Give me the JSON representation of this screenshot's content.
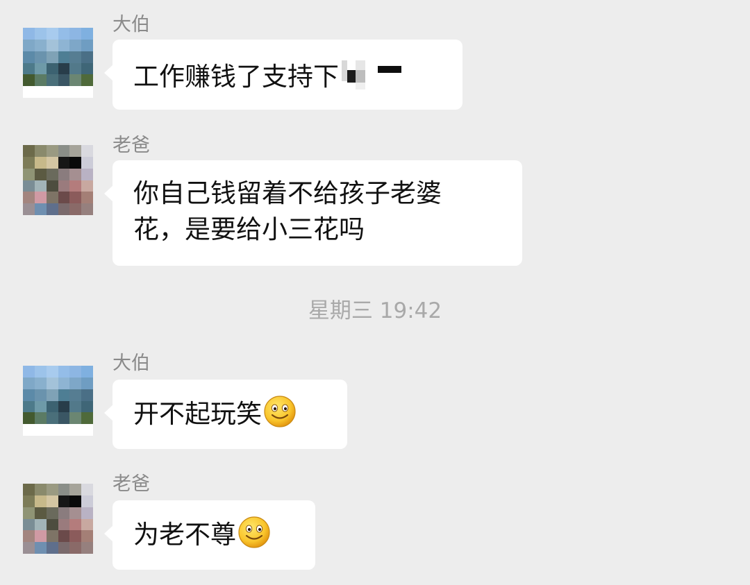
{
  "chat": {
    "messages": [
      {
        "sender": "大伯",
        "lines": [
          "工作赚钱了支持下"
        ],
        "attachment": "redacted-text-mosaic"
      },
      {
        "sender": "老爸",
        "lines": [
          "你自己钱留着不给孩子老婆",
          "花，是要给小三花吗"
        ]
      },
      {
        "sender": "大伯",
        "lines": [
          "开不起玩笑"
        ],
        "emoji": "smile-emoji"
      },
      {
        "sender": "老爸",
        "lines": [
          "为老不尊"
        ],
        "emoji": "smile-emoji"
      }
    ],
    "timestamp": "星期三 19:42"
  },
  "avatars": {
    "dabo": {
      "colors": [
        "#8fb8e6",
        "#9cc3ea",
        "#a8cbee",
        "#94bde8",
        "#8db6e3",
        "#7fb0e0",
        "#7fa8c7",
        "#89b0cd",
        "#a3c2d9",
        "#8eb4d3",
        "#7ea7c8",
        "#6f9dc2",
        "#5c8aa8",
        "#6a93ad",
        "#7fa2b6",
        "#4e7e94",
        "#567d92",
        "#4a6f86",
        "#4d7a8a",
        "#6e9aa8",
        "#3c6271",
        "#283d4a",
        "#52798a",
        "#3f6677",
        "#435a2f",
        "#5b7b64",
        "#4a6f7a",
        "#3a5664",
        "#6b8672",
        "#4f6a3a",
        "#ffffff",
        "#ffffff",
        "#ffffff",
        "#ffffff",
        "#ffffff",
        "#ffffff"
      ]
    },
    "dad": {
      "colors": [
        "#6c6a4a",
        "#8a8a6c",
        "#9a9a82",
        "#8a8e88",
        "#a6a49a",
        "#d9d9df",
        "#7d7c58",
        "#c7b98a",
        "#d4c6a3",
        "#161616",
        "#0a0a0a",
        "#ccccd8",
        "#8f9475",
        "#5b5a42",
        "#6a6a5c",
        "#8a7c7e",
        "#a58f91",
        "#b9b2c4",
        "#7a8d95",
        "#a2b4b8",
        "#4d4d3f",
        "#9a7b7d",
        "#b47c7c",
        "#c8a8a0",
        "#a3857f",
        "#d09aa4",
        "#7e7466",
        "#6b4a4a",
        "#8b5b5b",
        "#a47f76",
        "#9a8f94",
        "#6f8fb0",
        "#5f6f8c",
        "#7a6a6c",
        "#8a6a68",
        "#96807e"
      ]
    }
  }
}
